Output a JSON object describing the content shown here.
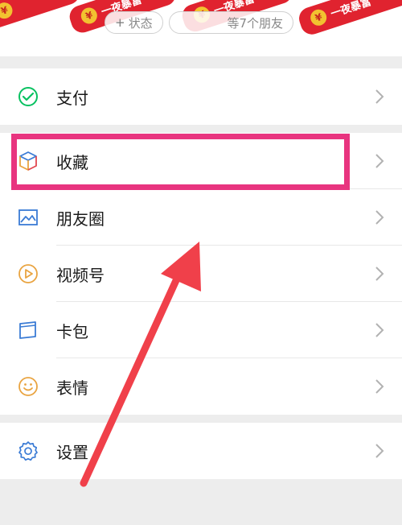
{
  "banner": {
    "moments_pill": "状态",
    "friends_pill": "等7个朋友",
    "sticker_text": "一夜暴富",
    "coin_symbol": "¥"
  },
  "menu": {
    "pay": "支付",
    "favorites": "收藏",
    "moments": "朋友圈",
    "channels": "视频号",
    "cards": "卡包",
    "stickers": "表情",
    "settings": "设置"
  },
  "colors": {
    "wechat_green": "#07c160",
    "highlight_pink": "#e8347f",
    "arrow_red": "#f0404a",
    "icon_blue": "#3a7bd5",
    "icon_orange": "#e9a441"
  }
}
